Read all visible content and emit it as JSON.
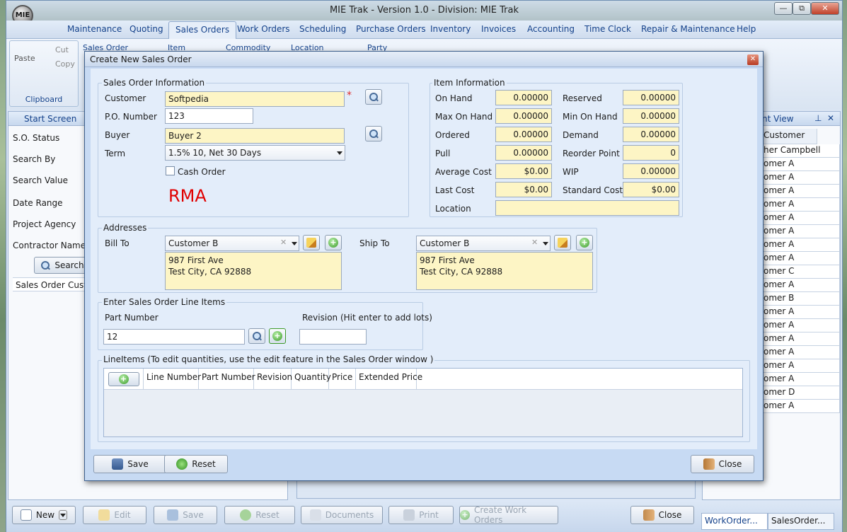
{
  "app": {
    "title": "MIE Trak - Version 1.0 - Division:  MIE Trak",
    "logo": "MIE"
  },
  "window_controls": {
    "minimize": "—",
    "restore": "⧉",
    "close": "✕"
  },
  "menu": [
    "Maintenance",
    "Quoting",
    "Sales Orders",
    "Work Orders",
    "Scheduling",
    "Purchase Orders",
    "Inventory",
    "Invoices",
    "Accounting",
    "Time Clock",
    "Repair & Maintenance",
    "Help"
  ],
  "menu_active": "Sales Orders",
  "ribbon": {
    "paste": "Paste",
    "cut": "Cut",
    "copy": "Copy",
    "clipboard_group": "Clipboard",
    "columns": [
      "Sales Order",
      "Item",
      "Commodity",
      "Location",
      "Party"
    ]
  },
  "left_panel": {
    "tab": "Start Screen",
    "fields": [
      "S.O. Status",
      "Search By",
      "Search Value",
      "Date Range",
      "Project Agency",
      "Contractor Name"
    ],
    "search_button": "Search",
    "columns": [
      "Sales Order",
      "Cust"
    ]
  },
  "right_panel": {
    "title": "nt View",
    "column": "Customer",
    "rows": [
      "her Campbell",
      "omer A",
      "omer A",
      "omer A",
      "omer A",
      "omer A",
      "omer A",
      "omer A",
      "omer A",
      "omer C",
      "omer A",
      "omer B",
      "omer A",
      "omer A",
      "omer A",
      "omer A",
      "omer A",
      "omer A",
      "omer D",
      "omer A"
    ]
  },
  "bottom_toolbar": {
    "new": "New",
    "edit": "Edit",
    "save": "Save",
    "reset": "Reset",
    "documents": "Documents",
    "print": "Print",
    "create_work_orders": "Create Work Orders",
    "close": "Close"
  },
  "bottom_tabs": [
    "WorkOrder...",
    "SalesOrder..."
  ],
  "dialog": {
    "title": "Create New Sales Order",
    "close_glyph": "✕",
    "sales_order_info": {
      "legend": "Sales Order Information",
      "customer_label": "Customer",
      "customer_value": "Softpedia",
      "required_mark": "*",
      "po_label": "P.O. Number",
      "po_value": "123",
      "buyer_label": "Buyer",
      "buyer_value": "Buyer 2",
      "term_label": "Term",
      "term_value": "1.5% 10, Net 30 Days",
      "cash_order_label": "Cash Order",
      "rma_text": "RMA"
    },
    "item_info": {
      "legend": "Item Information",
      "left": [
        {
          "label": "On Hand",
          "value": "0.00000"
        },
        {
          "label": "Max On Hand",
          "value": "0.00000"
        },
        {
          "label": "Ordered",
          "value": "0.00000"
        },
        {
          "label": "Pull",
          "value": "0.00000"
        },
        {
          "label": "Average Cost",
          "value": "$0.00"
        },
        {
          "label": "Last Cost",
          "value": "$0.00"
        }
      ],
      "right": [
        {
          "label": "Reserved",
          "value": "0.00000"
        },
        {
          "label": "Min On Hand",
          "value": "0.00000"
        },
        {
          "label": "Demand",
          "value": "0.00000"
        },
        {
          "label": "Reorder Point",
          "value": "0"
        },
        {
          "label": "WIP",
          "value": "0.00000"
        },
        {
          "label": "Standard Cost",
          "value": "$0.00"
        }
      ],
      "location_label": "Location",
      "location_value": ""
    },
    "addresses": {
      "legend": "Addresses",
      "bill_to_label": "Bill To",
      "bill_to_value": "Customer B",
      "bill_line1": "987 First Ave",
      "bill_line2": "Test City, CA 92888",
      "ship_to_label": "Ship To",
      "ship_to_value": "Customer B",
      "ship_line1": "987 First Ave",
      "ship_line2": "Test City, CA 92888",
      "clear_glyph": "✕"
    },
    "line_items_entry": {
      "legend": "Enter Sales Order Line Items",
      "part_number_label": "Part Number",
      "part_number_value": "12",
      "revision_label": "Revision (Hit enter to add lots)",
      "revision_value": ""
    },
    "line_items": {
      "legend": "LineItems (To edit quantities, use the edit feature in the Sales Order window )",
      "columns": [
        "Line Number",
        "Part Number",
        "Revision",
        "Quantity",
        "Price",
        "Extended Price"
      ]
    },
    "buttons": {
      "save": "Save",
      "reset": "Reset",
      "close": "Close"
    }
  },
  "colors": {
    "required": "#e03030",
    "rma": "#e00000",
    "yellow_field": "#fdf5c5",
    "accent": "#15428b"
  }
}
